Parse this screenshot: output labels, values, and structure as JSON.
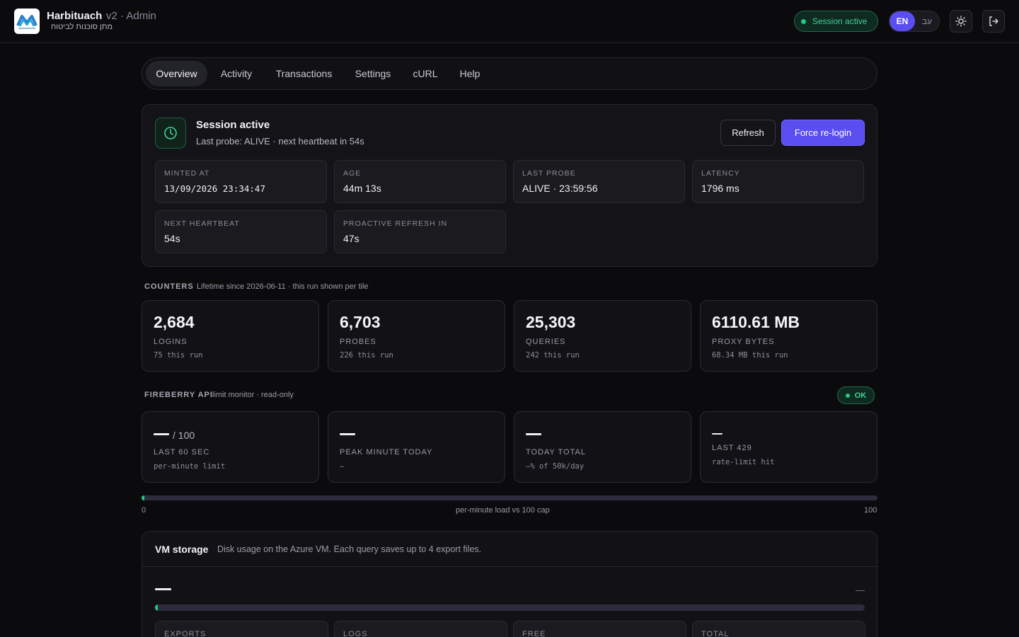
{
  "header": {
    "brand": "Harbituach",
    "version": "v2 · Admin",
    "subtitle": "מתן סוכנות לביטוח",
    "session_pill": "Session active",
    "lang_en": "EN",
    "lang_he": "עב"
  },
  "tabs": [
    "Overview",
    "Activity",
    "Transactions",
    "Settings",
    "cURL",
    "Help"
  ],
  "session": {
    "title": "Session active",
    "subtitle": "Last probe: ALIVE · next heartbeat in 54s",
    "refresh_label": "Refresh",
    "force_label": "Force re-login",
    "stats": [
      {
        "label": "MINTED AT",
        "value": "13/09/2026 23:34:47"
      },
      {
        "label": "AGE",
        "value": "44m 13s"
      },
      {
        "label": "LAST PROBE",
        "value": "ALIVE · 23:59:56"
      },
      {
        "label": "LATENCY",
        "value": "1796 ms"
      },
      {
        "label": "NEXT HEARTBEAT",
        "value": "54s"
      },
      {
        "label": "PROACTIVE REFRESH IN",
        "value": "47s"
      }
    ]
  },
  "counters": {
    "heading": "COUNTERS",
    "note": "Lifetime since 2026-06-11 · this run shown per tile",
    "tiles": [
      {
        "value": "2,684",
        "label": "LOGINS",
        "sub": "75 this run"
      },
      {
        "value": "6,703",
        "label": "PROBES",
        "sub": "226 this run"
      },
      {
        "value": "25,303",
        "label": "QUERIES",
        "sub": "242 this run"
      },
      {
        "value": "6110.61 MB",
        "label": "PROXY BYTES",
        "sub": "68.34 MB this run"
      }
    ]
  },
  "fireberry": {
    "heading": "FIREBERRY API",
    "note": "limit monitor · read-only",
    "status": "OK",
    "tiles": [
      {
        "cap": "/ 100",
        "label": "LAST 60 SEC",
        "sub": "per-minute limit"
      },
      {
        "label": "PEAK MINUTE TODAY",
        "sub": "—"
      },
      {
        "label": "TODAY TOTAL",
        "sub": "—% of 50k/day"
      },
      {
        "label": "LAST 429",
        "sub": "rate-limit hit"
      }
    ],
    "load_fraction": 0.003,
    "bar_min": "0",
    "bar_caption": "per-minute load vs 100 cap",
    "bar_max": "100"
  },
  "vm": {
    "title": "VM storage",
    "description": "Disk usage on the Azure VM. Each query saves up to 4 export files.",
    "usage_fraction": 0.003,
    "cells": [
      "EXPORTS",
      "LOGS",
      "FREE",
      "TOTAL"
    ]
  },
  "colors": {
    "accent": "#5b4ef0",
    "success": "#22c883",
    "background": "#0b0b0e"
  }
}
